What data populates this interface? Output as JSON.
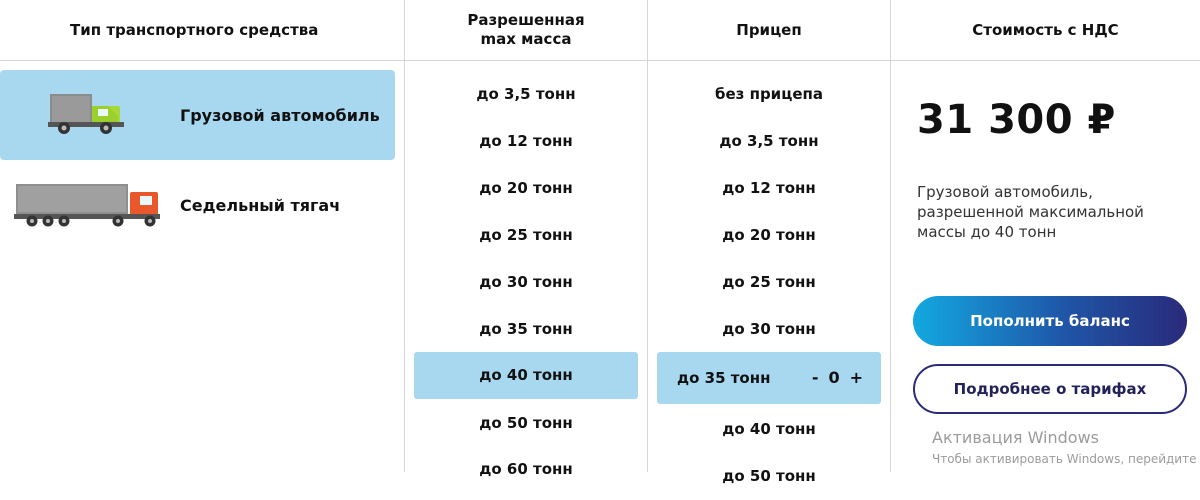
{
  "headers": {
    "vehicle_type": "Тип транспортного средства",
    "max_mass_line1": "Разрешенная",
    "max_mass_line2": "max масса",
    "trailer": "Прицеп",
    "cost": "Стоимость с НДС"
  },
  "vehicles": [
    {
      "label": "Грузовой автомобиль",
      "icon": "truck-icon",
      "selected": true
    },
    {
      "label": "Седельный тягач",
      "icon": "semi-truck-icon",
      "selected": false
    }
  ],
  "mass_options": [
    {
      "label": "до 3,5 тонн",
      "selected": false
    },
    {
      "label": "до 12 тонн",
      "selected": false
    },
    {
      "label": "до 20 тонн",
      "selected": false
    },
    {
      "label": "до 25 тонн",
      "selected": false
    },
    {
      "label": "до 30 тонн",
      "selected": false
    },
    {
      "label": "до 35 тонн",
      "selected": false
    },
    {
      "label": "до 40 тонн",
      "selected": true
    },
    {
      "label": "до 50 тонн",
      "selected": false
    },
    {
      "label": "до 60 тонн",
      "selected": false
    }
  ],
  "trailer_options": [
    {
      "label": "без прицепа"
    },
    {
      "label": "до 3,5 тонн"
    },
    {
      "label": "до 12 тонн"
    },
    {
      "label": "до 20 тонн"
    },
    {
      "label": "до 25 тонн"
    },
    {
      "label": "до 30 тонн"
    }
  ],
  "trailer_selected": {
    "label": "до 35 тонн",
    "minus": "-",
    "count": "0",
    "plus": "+"
  },
  "trailer_after": [
    {
      "label": "до 40 тонн"
    },
    {
      "label": "до 50 тонн"
    }
  ],
  "cost": {
    "price": "31 300 ₽",
    "description": "Грузовой автомобиль, разрешенной максимальной массы до 40 тонн",
    "topup_button": "Пополнить баланс",
    "details_button": "Подробнее о тарифах"
  },
  "watermark": {
    "title": "Активация Windows",
    "subtitle": "Чтобы активировать Windows, перейдите"
  },
  "colors": {
    "selected_bg": "#a8d8f0",
    "accent_dark": "#2a2a7a",
    "accent_light": "#13a9e0"
  }
}
